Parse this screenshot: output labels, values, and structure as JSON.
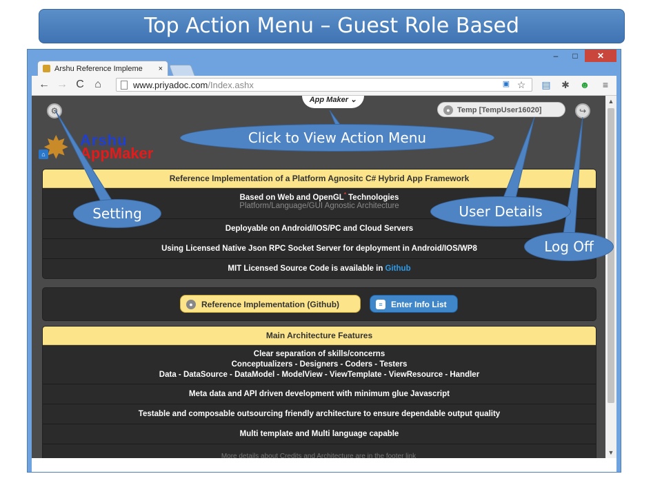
{
  "slide": {
    "title": "Top Action Menu – Guest Role Based"
  },
  "browser": {
    "tab_title": "Arshu Reference Impleme",
    "tab_close": "×",
    "url_host": "www.priyadoc.com",
    "url_path": "/Index.ashx",
    "win_minimize": "–",
    "win_maximize": "□",
    "win_close": "✕"
  },
  "page": {
    "app_maker_label": "App Maker",
    "user_label": "Temp [TempUser16020]",
    "logo_line1": "Arshu",
    "logo_line2": "AppMaker",
    "panel1": {
      "heading": "Reference Implementation of a Platform Agnositc C# Hybrid App Framework",
      "row1_main_a": "Based on Web and OpenGL",
      "row1_main_sup": "*",
      "row1_main_b": " Technologies",
      "row1_sub": "Platform/Language/GUI Agnostic Architecture",
      "row2": "Deployable on Android/IOS/PC and Cloud Servers",
      "row3": "Using Licensed Native Json RPC Socket Server for deployment in Android/IOS/WP8",
      "row4_text": "MIT Licensed Source Code is available in ",
      "row4_link": "Github"
    },
    "buttons": {
      "github": "Reference Implementation (Github)",
      "info_list": "Enter Info List"
    },
    "panel2": {
      "heading": "Main Architecture Features",
      "row1_l1": "Clear separation of skills/concerns",
      "row1_l2": "Conceptualizers - Designers - Coders - Testers",
      "row1_l3": "Data - DataSource - DataModel - ModelView - ViewTemplate - ViewResource - Handler",
      "row2": "Meta data and API driven development with minimum glue Javascript",
      "row3": "Testable and composable outsourcing friendly architecture to ensure dependable output quality",
      "row4": "Multi template and Multi language capable"
    },
    "footer_note": "More details about Credits and Architecture are in the footer link"
  },
  "callouts": {
    "action_menu": "Click to View Action Menu",
    "setting": "Setting",
    "user_details": "User Details",
    "log_off": "Log Off"
  },
  "colors": {
    "callout_blue": "#4f84c4",
    "panel_header": "#fbe489",
    "panel_body": "#2b2b2b",
    "link_blue": "#2d9be8"
  }
}
